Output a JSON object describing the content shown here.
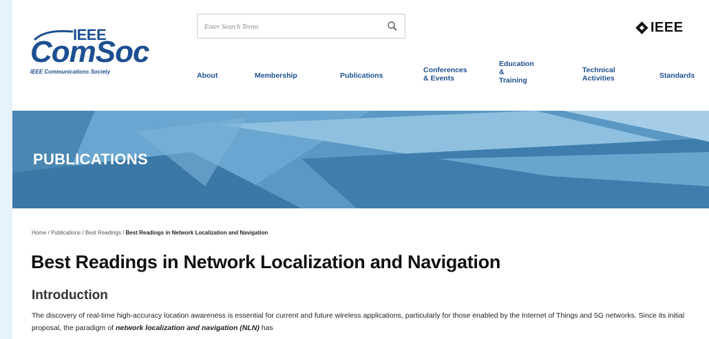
{
  "header": {
    "logo": {
      "top_text": "IEEE",
      "main_text": "ComSoc",
      "tagline": "IEEE Communications Society"
    },
    "search": {
      "placeholder": "Enter Search Terms",
      "icon": "search-icon"
    },
    "brand": {
      "text": "IEEE",
      "icon": "ieee-diamond-icon"
    }
  },
  "nav": {
    "items": [
      {
        "label": "About"
      },
      {
        "label": "Membership"
      },
      {
        "label": "Publications"
      },
      {
        "label_lines": [
          "Conferences",
          "& Events"
        ]
      },
      {
        "label_lines": [
          "Education",
          "&",
          "Training"
        ]
      },
      {
        "label_lines": [
          "Technical",
          "Activities"
        ]
      },
      {
        "label": "Standards"
      }
    ]
  },
  "hero": {
    "title": "PUBLICATIONS"
  },
  "breadcrumb": {
    "items": [
      "Home",
      "Publications",
      "Best Readings"
    ],
    "separator": " / ",
    "current": "Best Readings in Network Localization and Navigation"
  },
  "page": {
    "title": "Best Readings in Network Localization and Navigation",
    "section_heading": "Introduction",
    "intro": {
      "part1": "The discovery of real-time high-accuracy location awareness is essential for current and future wireless applications, particularly for those enabled by the Internet of Things and 5G networks. Since its initial proposal, the paradigm of ",
      "emphasis": "network localization and navigation (NLN)",
      "part2": " has"
    }
  },
  "colors": {
    "brand_blue": "#1d4f91",
    "hero_blue": "#4d8dba",
    "outer_bg": "#e4f2fb"
  }
}
